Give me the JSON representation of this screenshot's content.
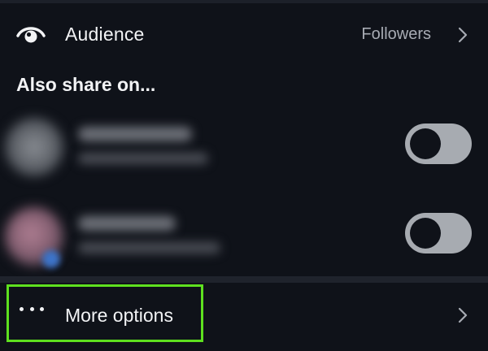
{
  "audience": {
    "label": "Audience",
    "value": "Followers",
    "icon": "eye-icon"
  },
  "share_section": {
    "title": "Also share on...",
    "accounts": [
      {
        "toggle_on": false
      },
      {
        "toggle_on": false
      }
    ]
  },
  "more_options": {
    "label": "More options",
    "icon": "more-dots-icon",
    "highlight_color": "#5ee01f"
  },
  "colors": {
    "background": "#0f1219",
    "toggle_track": "#a7abb1",
    "secondary_text": "#a7abb3"
  }
}
